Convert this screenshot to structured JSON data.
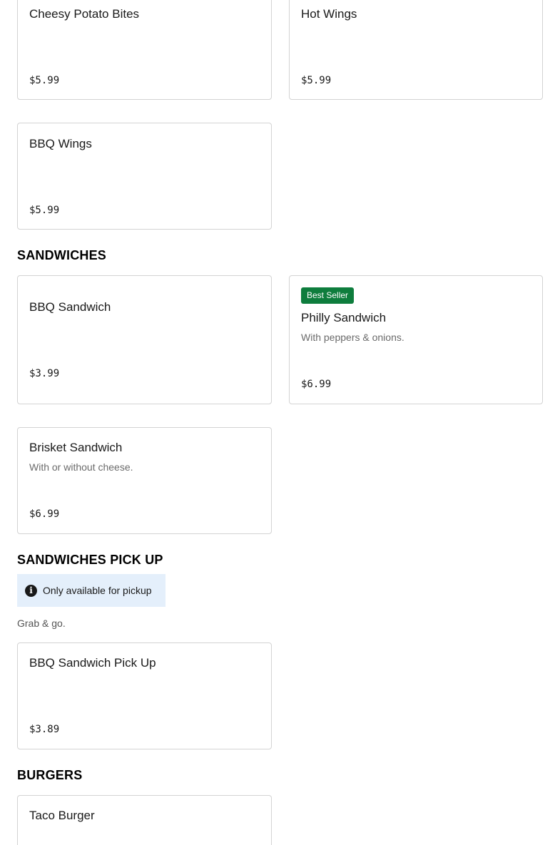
{
  "top_items": [
    {
      "name": "Cheesy Potato Bites",
      "price": "$5.99"
    },
    {
      "name": "Hot Wings",
      "price": "$5.99"
    },
    {
      "name": "BBQ Wings",
      "price": "$5.99"
    }
  ],
  "sections": {
    "sandwiches": {
      "title": "SANDWICHES",
      "items": [
        {
          "name": "BBQ Sandwich",
          "price": "$3.99"
        },
        {
          "badge": "Best Seller",
          "name": "Philly Sandwich",
          "description": "With peppers & onions.",
          "price": "$6.99"
        },
        {
          "name": "Brisket Sandwich",
          "description": "With or without cheese.",
          "price": "$6.99"
        }
      ]
    },
    "sandwiches_pick_up": {
      "title": "SANDWICHES PICK UP",
      "notice": "Only available for pickup",
      "notice_icon": "info-icon",
      "description": "Grab & go.",
      "items": [
        {
          "name": "BBQ Sandwich Pick Up",
          "price": "$3.89"
        }
      ]
    },
    "burgers": {
      "title": "BURGERS",
      "items": [
        {
          "name": "Taco Burger"
        }
      ]
    }
  },
  "colors": {
    "badge_background": "#0e7d3d",
    "notice_background": "#e4effb",
    "card_border": "#d3d3d3"
  }
}
